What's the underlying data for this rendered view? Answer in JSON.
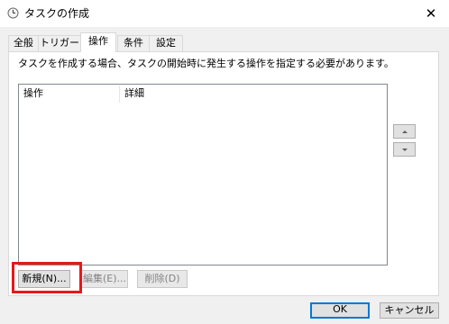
{
  "window": {
    "title": "タスクの作成",
    "icons": {
      "title": "clock-icon",
      "close": "close-icon"
    }
  },
  "tabs": [
    {
      "label": "全般",
      "active": false
    },
    {
      "label": "トリガー",
      "active": false
    },
    {
      "label": "操作",
      "active": true
    },
    {
      "label": "条件",
      "active": false
    },
    {
      "label": "設定",
      "active": false
    }
  ],
  "description": "タスクを作成する場合、タスクの開始時に発生する操作を指定する必要があります。",
  "list": {
    "columns": [
      "操作",
      "詳細"
    ],
    "rows": []
  },
  "buttons": {
    "new": "新規(N)...",
    "edit": "編集(E)...",
    "delete": "削除(D)",
    "ok": "OK",
    "cancel": "キャンセル"
  },
  "colors": {
    "highlight": "#e8171a",
    "default_button_border": "#0078d7"
  }
}
